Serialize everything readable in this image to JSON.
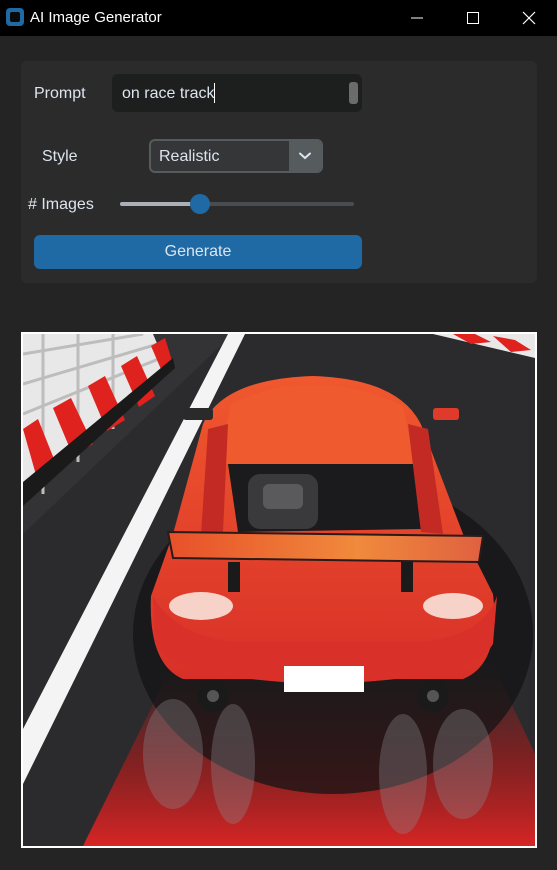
{
  "window": {
    "title": "AI Image Generator",
    "icons": {
      "app": "app-icon",
      "minimize": "minimize-icon",
      "maximize": "maximize-icon",
      "close": "close-icon"
    }
  },
  "form": {
    "prompt_label": "Prompt",
    "prompt_value": "on race track",
    "style_label": "Style",
    "style_value": "Realistic",
    "images_label": "# Images",
    "images_slider_fraction": 0.34,
    "generate_label": "Generate"
  },
  "colors": {
    "background": "#242424",
    "frame": "#2b2b2b",
    "accent": "#1f6aa5",
    "titlebar": "#000000"
  }
}
